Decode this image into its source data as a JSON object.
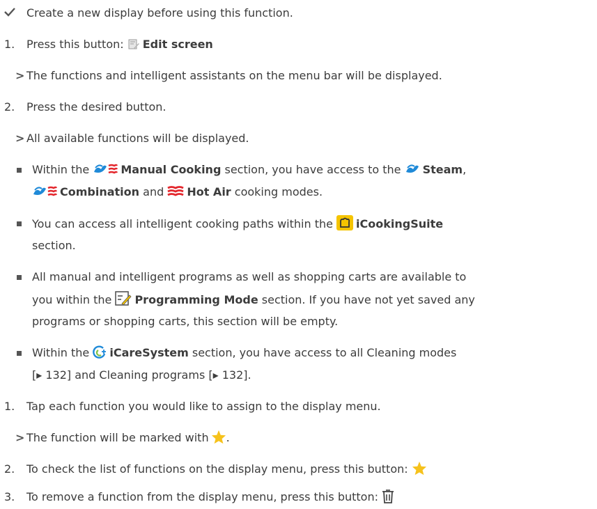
{
  "colors": {
    "steam_blue": "#1f8ad8",
    "hotair_red": "#e3262c",
    "suite_yellow": "#f5c400",
    "star_yellow": "#f6c21c",
    "text_gray": "#3c3c3c"
  },
  "icons": [
    "check-icon",
    "edit-screen-icon",
    "steam-icon",
    "hot-air-icon",
    "combination-icon",
    "icookingsuite-icon",
    "programming-mode-icon",
    "icaresystem-icon",
    "star-icon",
    "trash-icon"
  ],
  "prereq": {
    "text": "Create a new display before using this function."
  },
  "steps1": [
    {
      "num": "1.",
      "text": "Press this button: ",
      "button": "Edit screen"
    },
    {
      "num": "2.",
      "text": "Press the desired button."
    }
  ],
  "results1": [
    {
      "marker": ">",
      "text": "The functions and intelligent assistants on the menu bar will be displayed."
    },
    {
      "marker": ">",
      "text": "All available functions will be displayed."
    }
  ],
  "bullets": {
    "manual": {
      "pre": "Within the ",
      "name": "Manual Cooking",
      "mid": " section, you have access to the ",
      "steam": "Steam",
      "comma": ",",
      "combination": "Combination",
      "and": " and ",
      "hotair": "Hot Air",
      "post": " cooking modes."
    },
    "suite": {
      "pre": "You can access all intelligent cooking paths within the ",
      "name": "iCookingSuite",
      "post": "section."
    },
    "programming": {
      "line1": "All manual and intelligent programs as well as shopping carts are available to",
      "pre": "you within the ",
      "name": "Programming Mode",
      "post": " section. If you have not yet saved any",
      "line3": "programs or shopping carts, this section will be empty."
    },
    "icare": {
      "pre": "Within the ",
      "name": "iCareSystem",
      "post": " section, you have access to all Cleaning modes",
      "line2": "[▸ 132] and Cleaning programs [▸ 132]."
    }
  },
  "steps2": [
    {
      "num": "1.",
      "text": "Tap each function you would like to assign to the display menu."
    },
    {
      "marker": ">",
      "text": "The function will be marked with ",
      "end": "."
    },
    {
      "num": "2.",
      "text": "To check the list of functions on the display menu, press this button: "
    },
    {
      "num": "3.",
      "text": "To remove a function from the display menu, press this button: "
    }
  ]
}
